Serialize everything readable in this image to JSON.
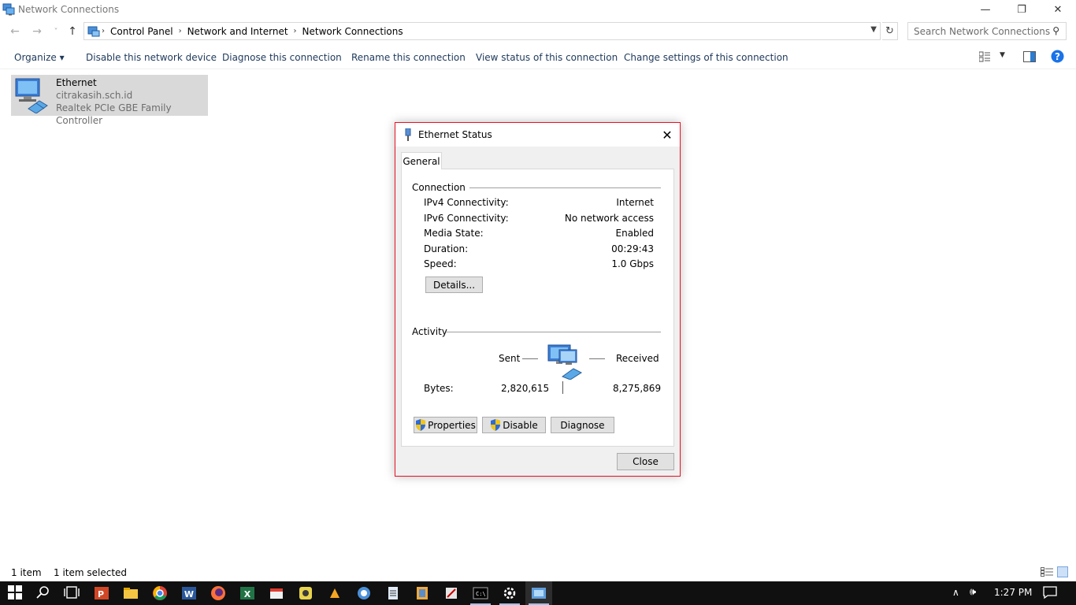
{
  "window": {
    "title": "Network Connections",
    "minimize": "—",
    "restore": "❐",
    "close": "✕"
  },
  "nav": {
    "back": "←",
    "forward": "→",
    "recent": "˅",
    "up": "↑"
  },
  "address": {
    "crumbs": [
      "Control Panel",
      "Network and Internet",
      "Network Connections"
    ],
    "search_placeholder": "Search Network Connections"
  },
  "commands": {
    "organize": "Organize ▾",
    "disable": "Disable this network device",
    "diagnose": "Diagnose this connection",
    "rename": "Rename this connection",
    "view_status": "View status of this connection",
    "change_settings": "Change settings of this connection"
  },
  "item": {
    "name": "Ethernet",
    "domain": "citrakasih.sch.id",
    "adapter": "Realtek PCIe GBE Family Controller"
  },
  "status": {
    "count": "1 item",
    "selected": "1 item selected"
  },
  "dialog": {
    "title": "Ethernet Status",
    "tab": "General",
    "connection_label": "Connection",
    "rows": [
      {
        "label": "IPv4 Connectivity:",
        "value": "Internet"
      },
      {
        "label": "IPv6 Connectivity:",
        "value": "No network access"
      },
      {
        "label": "Media State:",
        "value": "Enabled"
      },
      {
        "label": "Duration:",
        "value": "00:29:43"
      },
      {
        "label": "Speed:",
        "value": "1.0 Gbps"
      }
    ],
    "details_button": "Details...",
    "activity_label": "Activity",
    "sent_label": "Sent",
    "received_label": "Received",
    "bytes_label": "Bytes:",
    "bytes_sent": "2,820,615",
    "bytes_received": "8,275,869",
    "properties_button": "Properties",
    "disable_button": "Disable",
    "diagnose_button": "Diagnose",
    "close_button": "Close"
  },
  "taskbar": {
    "clock": "1:27 PM",
    "tray_up": "∧",
    "volume": "🕪"
  },
  "colors": {
    "accent": "#1e395b",
    "dialog_border": "#e81123",
    "help_blue": "#1a73e8",
    "taskbar": "#101010"
  }
}
